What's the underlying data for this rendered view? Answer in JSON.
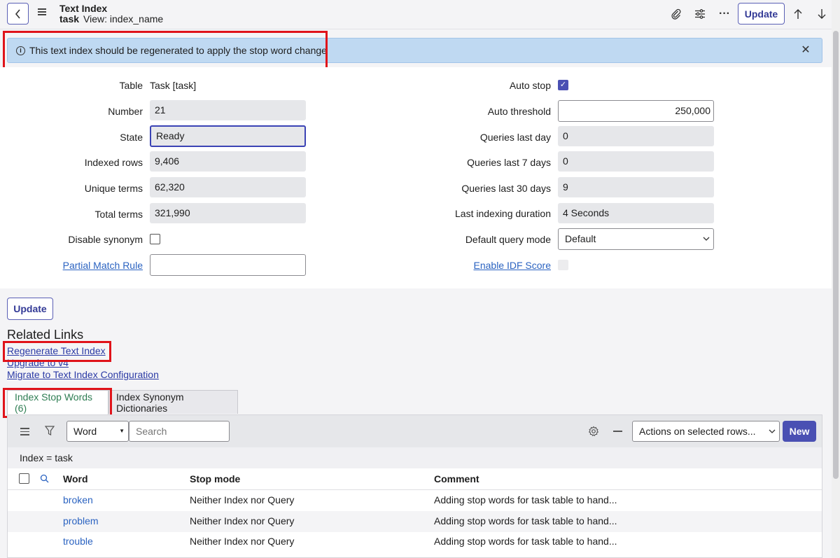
{
  "header": {
    "title": "Text Index",
    "table_name": "task",
    "view_label": "View: index_name",
    "update_label": "Update"
  },
  "banner": {
    "message": "This text index should be regenerated to apply the stop word change"
  },
  "form": {
    "left": [
      {
        "label": "Table",
        "value": "Task [task]"
      },
      {
        "label": "Number",
        "value": "21"
      },
      {
        "label": "State",
        "value": "Ready"
      },
      {
        "label": "Indexed rows",
        "value": "9,406"
      },
      {
        "label": "Unique terms",
        "value": "62,320"
      },
      {
        "label": "Total terms",
        "value": "321,990"
      },
      {
        "label": "Disable synonym",
        "value": ""
      },
      {
        "label": "Partial Match Rule",
        "value": ""
      }
    ],
    "right": [
      {
        "label": "Auto stop",
        "value": ""
      },
      {
        "label": "Auto threshold",
        "value": "250,000"
      },
      {
        "label": "Queries last day",
        "value": "0"
      },
      {
        "label": "Queries last 7 days",
        "value": "0"
      },
      {
        "label": "Queries last 30 days",
        "value": "9"
      },
      {
        "label": "Last indexing duration",
        "value": "4 Seconds"
      },
      {
        "label": "Default query mode",
        "value": "Default"
      },
      {
        "label": "Enable IDF Score",
        "value": ""
      }
    ],
    "update_label": "Update"
  },
  "related": {
    "title": "Related Links",
    "links": [
      "Regenerate Text Index",
      "Upgrade to v4",
      "Migrate to Text Index Configuration"
    ]
  },
  "tabs": [
    "Index Stop Words (6)",
    "Index Synonym Dictionaries"
  ],
  "list": {
    "search_field": "Word",
    "search_placeholder": "Search",
    "actions_label": "Actions on selected rows...",
    "new_label": "New",
    "filter": "Index = task",
    "columns": [
      "Word",
      "Stop mode",
      "Comment"
    ],
    "rows": [
      {
        "word": "broken",
        "mode": "Neither Index nor Query",
        "comment": "Adding stop words for task table to hand..."
      },
      {
        "word": "problem",
        "mode": "Neither Index nor Query",
        "comment": "Adding stop words for task table to hand..."
      },
      {
        "word": "trouble",
        "mode": "Neither Index nor Query",
        "comment": "Adding stop words for task table to hand..."
      }
    ]
  }
}
